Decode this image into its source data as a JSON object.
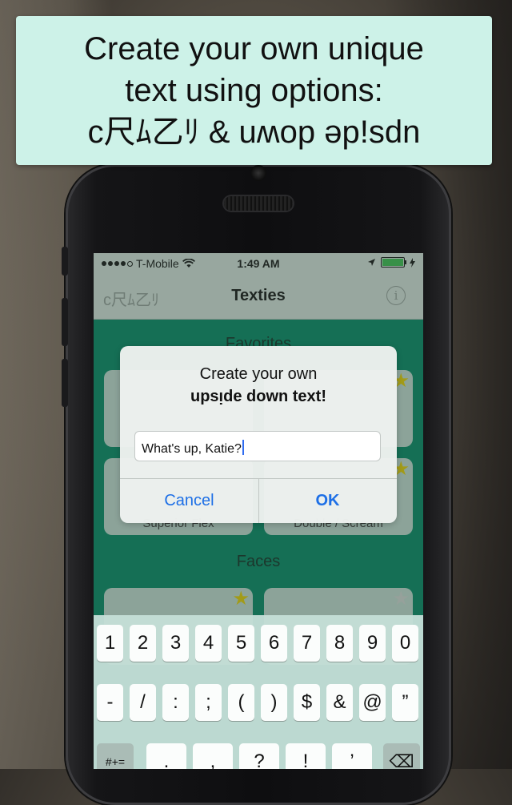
{
  "banner": {
    "line1": "Create your own unique",
    "line2": "text using options:",
    "line3": "c尺ﾑ乙ﾘ & uʍop əp!sdn"
  },
  "status_bar": {
    "carrier": "T-Mobile",
    "time": "1:49 AM",
    "signal_bars": 4,
    "battery_level": 1.0
  },
  "nav": {
    "left_label": "c尺ﾑ乙ﾘ",
    "title": "Texties",
    "info_icon": "i"
  },
  "sections": {
    "favorites": "Favorites",
    "faces": "Faces"
  },
  "cards": {
    "c1_label": "",
    "c2_label": "",
    "c3_label": "Superior Flex",
    "c4_label": "Double / Scream"
  },
  "alert": {
    "title": "Create your own",
    "subtitle": "upsᴉde down text!",
    "input_value": "What's up, Katie?",
    "cancel_label": "Cancel",
    "ok_label": "OK"
  },
  "keyboard": {
    "row1": [
      "1",
      "2",
      "3",
      "4",
      "5",
      "6",
      "7",
      "8",
      "9",
      "0"
    ],
    "row2": [
      "-",
      "/",
      ":",
      ";",
      "(",
      ")",
      "$",
      "&",
      "@",
      "”"
    ],
    "row3": [
      "#+=",
      ".",
      ",",
      "?",
      "!",
      "’",
      "⌫"
    ]
  },
  "colors": {
    "banner_bg": "#cdf2e8",
    "app_green": "#01805f",
    "accent_blue": "#1d6fe6",
    "star_yellow": "#d9c400"
  }
}
